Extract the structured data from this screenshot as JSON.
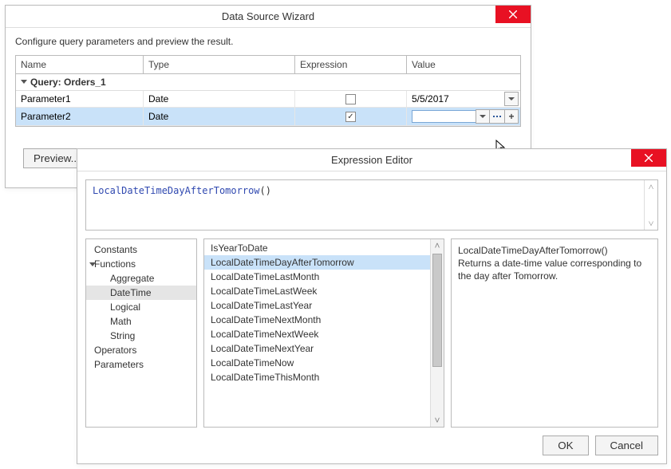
{
  "dsw": {
    "title": "Data Source Wizard",
    "message": "Configure query parameters and preview the result.",
    "columns": {
      "name": "Name",
      "type": "Type",
      "expression": "Expression",
      "value": "Value"
    },
    "group_label": "Query: Orders_1",
    "rows": [
      {
        "name": "Parameter1",
        "type": "Date",
        "expression": false,
        "value": "5/5/2017"
      },
      {
        "name": "Parameter2",
        "type": "Date",
        "expression": true,
        "value": ""
      }
    ],
    "preview_label": "Preview..."
  },
  "ee": {
    "title": "Expression Editor",
    "expression_name": "LocalDateTimeDayAfterTomorrow",
    "expression_args": "()",
    "tree": {
      "constants": "Constants",
      "functions": "Functions",
      "functions_children": {
        "aggregate": "Aggregate",
        "datetime": "DateTime",
        "logical": "Logical",
        "math": "Math",
        "string": "String"
      },
      "operators": "Operators",
      "parameters": "Parameters",
      "selected": "datetime"
    },
    "functions_list": [
      "IsYearToDate",
      "LocalDateTimeDayAfterTomorrow",
      "LocalDateTimeLastMonth",
      "LocalDateTimeLastWeek",
      "LocalDateTimeLastYear",
      "LocalDateTimeNextMonth",
      "LocalDateTimeNextWeek",
      "LocalDateTimeNextYear",
      "LocalDateTimeNow",
      "LocalDateTimeThisMonth"
    ],
    "selected_function_index": 1,
    "description": {
      "heading": "LocalDateTimeDayAfterTomorrow()",
      "body": "Returns a date-time value corresponding to the day after Tomorrow."
    },
    "ok_label": "OK",
    "cancel_label": "Cancel"
  }
}
